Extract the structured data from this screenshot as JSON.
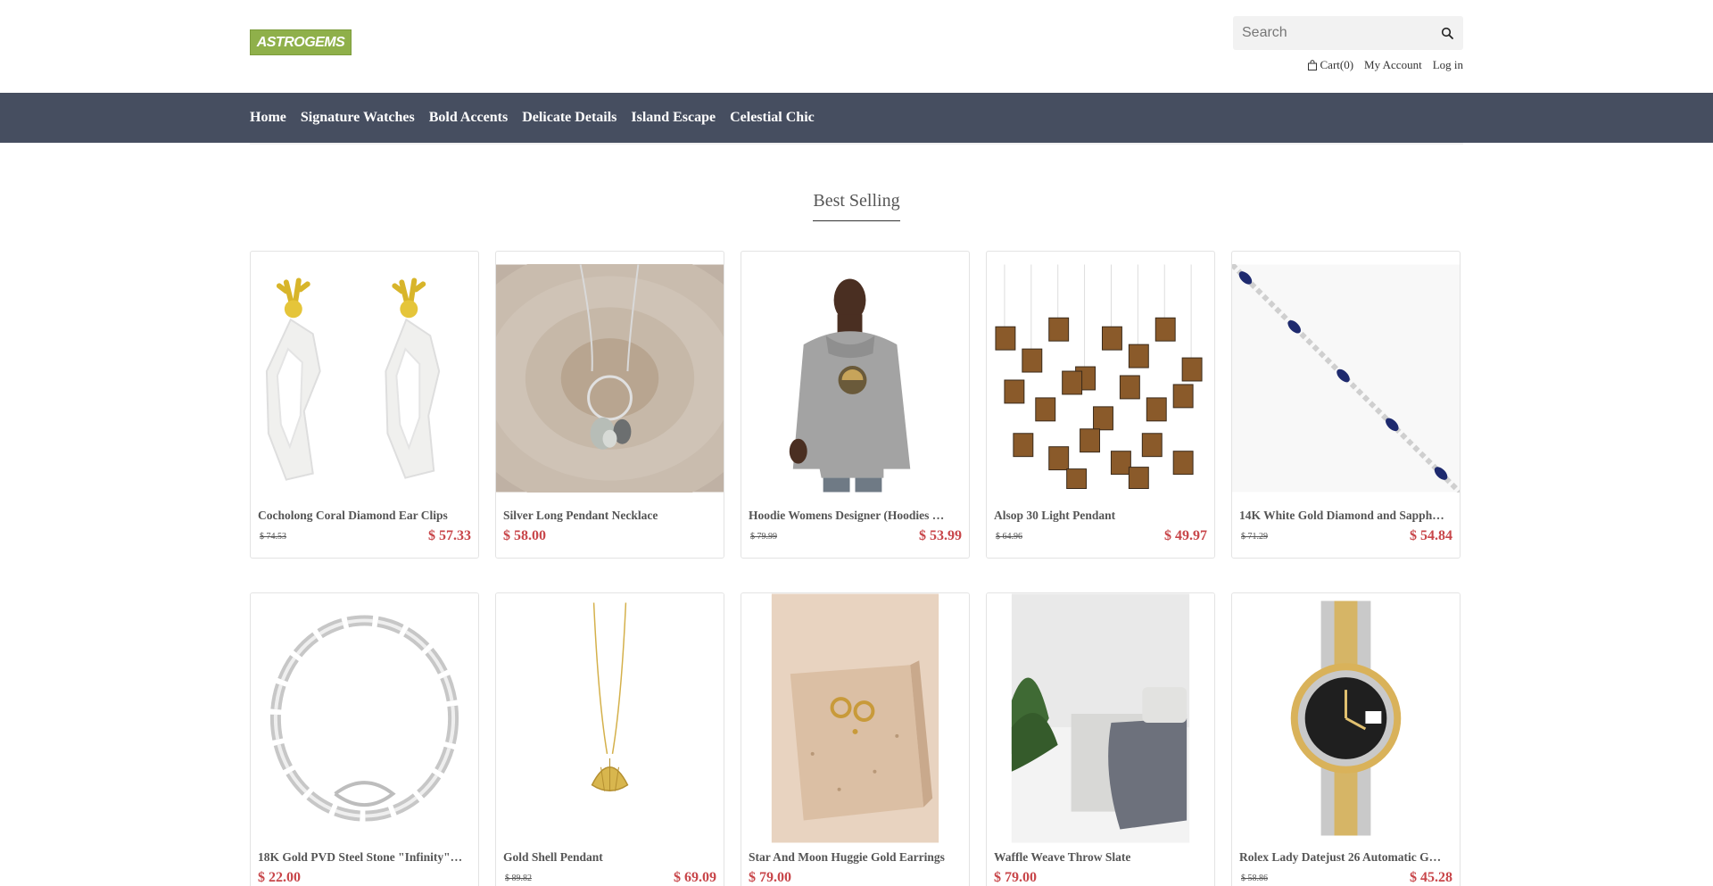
{
  "brand": {
    "logo_text": "ASTROGEMS"
  },
  "search": {
    "placeholder": "Search"
  },
  "header_links": {
    "cart": "Cart(0)",
    "account": "My Account",
    "login": "Log in"
  },
  "nav": [
    "Home",
    "Signature Watches",
    "Bold Accents",
    "Delicate Details",
    "Island Escape",
    "Celestial Chic"
  ],
  "section": {
    "title": "Best Selling"
  },
  "products": [
    {
      "name": "Cocholong Coral Diamond Ear Clips",
      "old_price": "$ 74.53",
      "price": "$ 57.33",
      "image": "earrings-icon"
    },
    {
      "name": "Silver Long Pendant Necklace",
      "old_price": "",
      "price": "$ 58.00",
      "image": "necklace-on-wood-icon"
    },
    {
      "name": "Hoodie Womens Designer (Hoodies …",
      "old_price": "$ 79.99",
      "price": "$ 53.99",
      "image": "hoodie-model-icon"
    },
    {
      "name": "Alsop 30 Light Pendant",
      "old_price": "$ 64.96",
      "price": "$ 49.97",
      "image": "pendant-light-icon"
    },
    {
      "name": "14K White Gold Diamond and Sapph…",
      "old_price": "$ 71.29",
      "price": "$ 54.84",
      "image": "sapphire-bracelet-icon"
    },
    {
      "name": "18K Gold PVD Steel Stone \"Infinity\"…",
      "old_price": "",
      "price": "$ 22.00",
      "image": "chain-bracelet-icon"
    },
    {
      "name": "Gold Shell Pendant",
      "old_price": "$ 89.82",
      "price": "$ 69.09",
      "image": "shell-pendant-icon"
    },
    {
      "name": "Star And Moon Huggie Gold Earrings",
      "old_price": "",
      "price": "$ 79.00",
      "image": "huggie-earrings-icon"
    },
    {
      "name": "Waffle Weave Throw Slate",
      "old_price": "",
      "price": "$ 79.00",
      "image": "throw-blanket-icon"
    },
    {
      "name": "Rolex Lady Datejust 26 Automatic G…",
      "old_price": "$ 58.86",
      "price": "$ 45.28",
      "image": "rolex-watch-icon"
    }
  ],
  "colors": {
    "nav_bg": "#464e60",
    "price": "#c8464a",
    "logo_bg": "#8fb04a"
  }
}
